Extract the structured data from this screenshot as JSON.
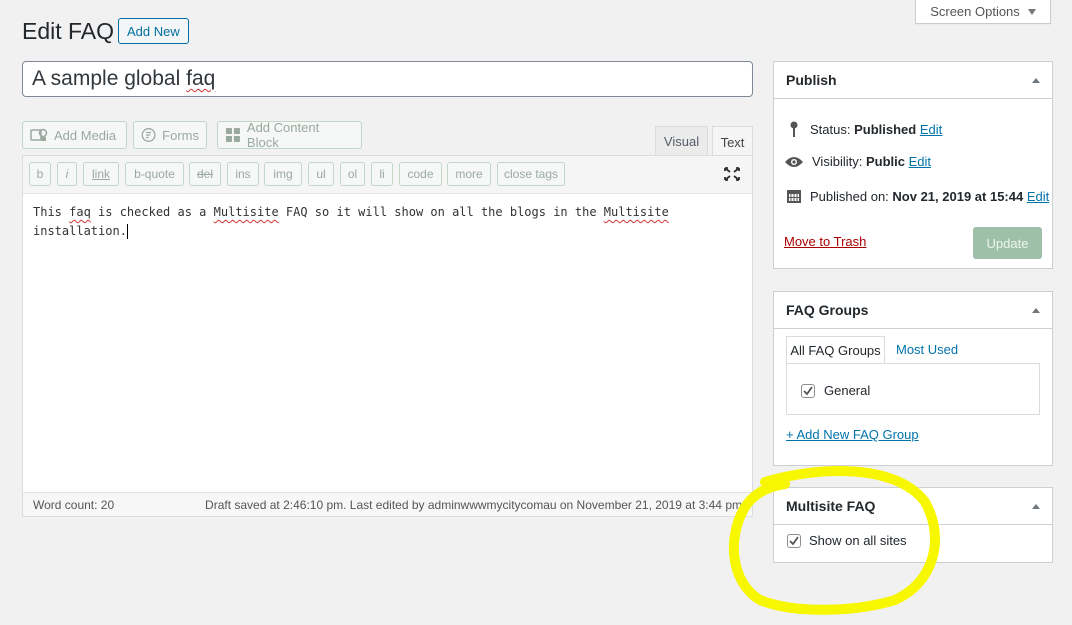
{
  "screen_options": {
    "label": "Screen Options"
  },
  "header": {
    "title": "Edit FAQ",
    "add_new": "Add New"
  },
  "post": {
    "title_text": "A sample global ",
    "title_misspelled": "faq"
  },
  "media_buttons": {
    "add_media": "Add Media",
    "forms": "Forms",
    "add_content_block": "Add Content Block"
  },
  "editor_tabs": {
    "visual": "Visual",
    "text": "Text"
  },
  "quicktags": [
    "b",
    "i",
    "link",
    "b-quote",
    "del",
    "ins",
    "img",
    "ul",
    "ol",
    "li",
    "code",
    "more",
    "close tags"
  ],
  "content": {
    "line1_a": "This ",
    "line1_faq": "faq",
    "line1_b": " is checked as a ",
    "line1_multisite": "Multisite",
    "line1_c": " FAQ so it will show on all the blogs in the ",
    "line1_multisite2": "Multisite",
    "line2": "installation."
  },
  "status_bar": {
    "word_count": "Word count: 20",
    "draft_saved": "Draft saved at 2:46:10 pm. Last edited by adminwwwmycitycomau on November 21, 2019 at 3:44 pm"
  },
  "publish": {
    "title": "Publish",
    "status_label": "Status: ",
    "status_value": "Published",
    "visibility_label": "Visibility: ",
    "visibility_value": "Public",
    "published_label": "Published on: ",
    "published_value": "Nov 21, 2019 at 15:44",
    "edit": "Edit",
    "trash": "Move to Trash",
    "update": "Update"
  },
  "faq_groups": {
    "title": "FAQ Groups",
    "tab_all": "All FAQ Groups",
    "tab_most_used": "Most Used",
    "items": [
      {
        "label": "General",
        "checked": true
      }
    ],
    "add_new": "+ Add New FAQ Group"
  },
  "multisite_faq": {
    "title": "Multisite FAQ",
    "show_on_all_sites": "Show on all sites",
    "checked": true
  },
  "colors": {
    "accent": "#0073aa",
    "highlight": "#f7f700",
    "trash": "#a00",
    "update_bg": "#9fc0a8"
  }
}
